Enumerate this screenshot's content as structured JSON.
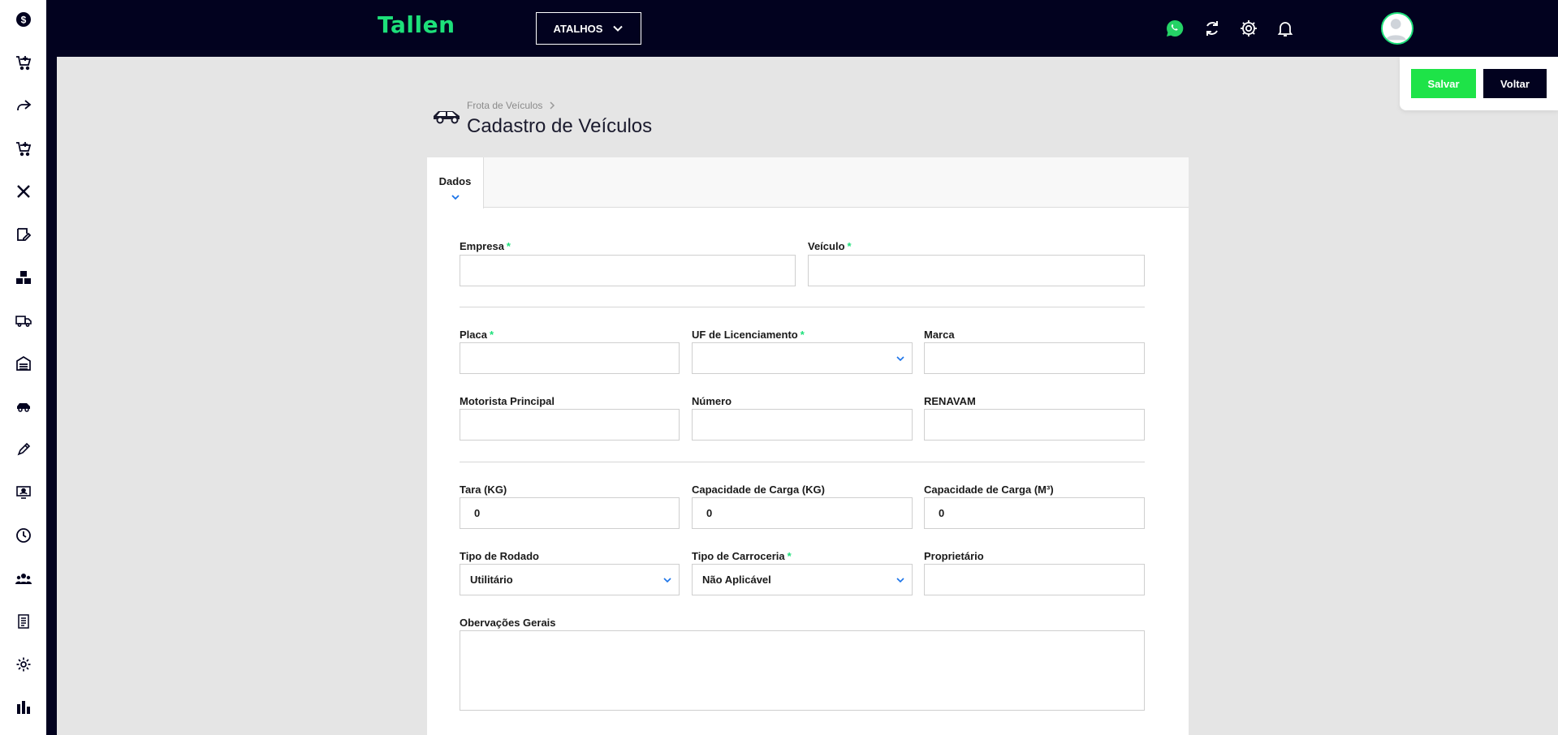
{
  "app": {
    "brand": "Tallen",
    "shortcuts_label": "ATALHOS"
  },
  "sidebar": {
    "items": [
      {
        "icon": "dollar-icon"
      },
      {
        "icon": "cart-add-icon"
      },
      {
        "icon": "share-arrow-icon"
      },
      {
        "icon": "cart-add-icon"
      },
      {
        "icon": "tools-icon"
      },
      {
        "icon": "edit-note-icon"
      },
      {
        "icon": "boxes-icon"
      },
      {
        "icon": "truck-icon"
      },
      {
        "icon": "warehouse-icon"
      },
      {
        "icon": "car-icon"
      },
      {
        "icon": "pen-icon"
      },
      {
        "icon": "monitor-user-icon"
      },
      {
        "icon": "clock-icon"
      },
      {
        "icon": "users-icon"
      },
      {
        "icon": "document-list-icon"
      },
      {
        "icon": "gear-icon"
      },
      {
        "icon": "bar-chart-icon"
      }
    ]
  },
  "topbar_icons": [
    "whatsapp-icon",
    "refresh-icon",
    "gear-icon",
    "bell-icon"
  ],
  "actions": {
    "save_label": "Salvar",
    "back_label": "Voltar"
  },
  "header": {
    "breadcrumb": "Frota de Veículos",
    "title": "Cadastro de Veículos"
  },
  "tabs": [
    {
      "label": "Dados"
    }
  ],
  "form": {
    "empresa": {
      "label": "Empresa",
      "required": "*",
      "value": ""
    },
    "veiculo": {
      "label": "Veículo",
      "required": "*",
      "value": ""
    },
    "placa": {
      "label": "Placa",
      "required": "*",
      "value": ""
    },
    "uf": {
      "label": "UF de Licenciamento",
      "required": "*",
      "value": ""
    },
    "marca": {
      "label": "Marca",
      "value": ""
    },
    "motorista": {
      "label": "Motorista Principal",
      "value": ""
    },
    "numero": {
      "label": "Número",
      "value": ""
    },
    "renavam": {
      "label": "RENAVAM",
      "value": ""
    },
    "tara": {
      "label": "Tara (KG)",
      "value": "0"
    },
    "cap_kg": {
      "label": "Capacidade de Carga (KG)",
      "value": "0"
    },
    "cap_m3": {
      "label": "Capacidade de Carga (M³)",
      "value": "0"
    },
    "rodado": {
      "label": "Tipo de Rodado",
      "value": "Utilitário"
    },
    "carroceria": {
      "label": "Tipo de Carroceria",
      "required": "*",
      "value": "Não Aplicável"
    },
    "proprietario": {
      "label": "Proprietário",
      "value": ""
    },
    "observacoes": {
      "label": "Obervações Gerais",
      "value": ""
    }
  },
  "colors": {
    "navy": "#02021f",
    "brand_green": "#1de07a",
    "save_green": "#1ee348",
    "select_chevron": "#1a73e8"
  }
}
